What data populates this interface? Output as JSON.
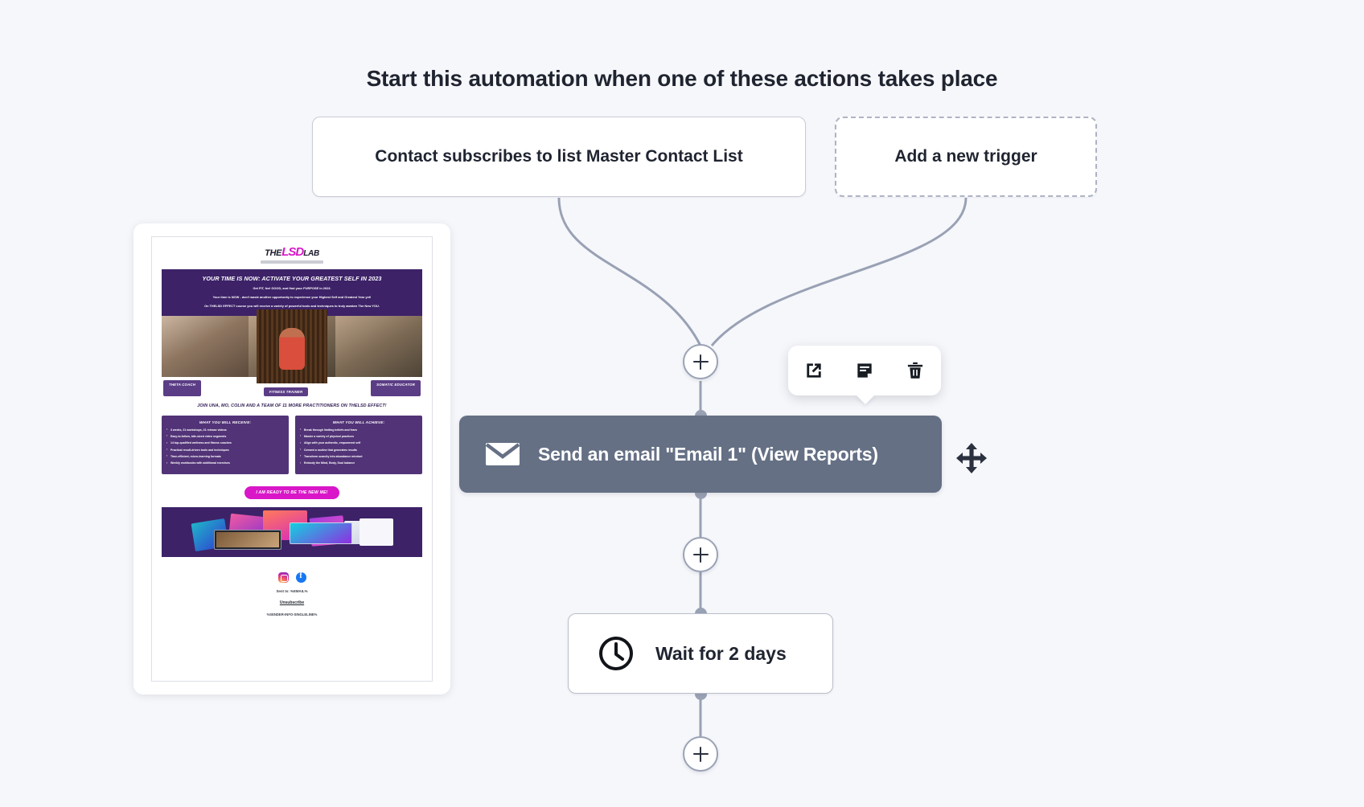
{
  "page": {
    "title": "Start this automation when one of these actions takes place"
  },
  "triggers": [
    {
      "label": "Contact subscribes to list Master Contact List",
      "style": "solid"
    },
    {
      "label": "Add a new trigger",
      "style": "dashed"
    }
  ],
  "nodes": {
    "email": {
      "label": "Send an email \"Email 1\" (View Reports)",
      "icon": "envelope-icon",
      "background": "#657085"
    },
    "wait": {
      "label": "Wait for 2 days",
      "icon": "clock-icon",
      "background": "#ffffff"
    }
  },
  "add_buttons": {
    "top_label": "+",
    "middle_label": "+",
    "bottom_label": "+"
  },
  "toolbar": {
    "open_icon": "external-link-icon",
    "duplicate_icon": "duplicate-icon",
    "delete_icon": "trash-icon"
  },
  "drag_handle": {
    "icon": "move-arrows-icon"
  },
  "email_preview": {
    "logo_the": "THE",
    "logo_lsd": "LSD",
    "logo_lab": "LAB",
    "hero_heading": "YOUR TIME IS NOW: ACTIVATE YOUR GREATEST SELF IN 2023",
    "hero_line1": "Get FIT, feel GOOD, and find your PURPOSE in 2023.",
    "hero_line2": "Your time is NOW - don't waste another opportunity to experience your Highest Self and Greatest Year yet!",
    "hero_line3": "On THELSD EFFECT course you will receive a variety of powerful tools and techniques to truly awaken The New YOU.",
    "roles": [
      "THETA COACH",
      "FITNESS TRAINER",
      "SOMATIC EDUCATOR"
    ],
    "join_line": "JOIN UNA, MO, COLIN AND A TEAM OF 11 MORE PRACTITIONERS ON THELSD EFFECT!",
    "receive_title": "WHAT YOU WILL RECEIVE:",
    "receive_items": [
      "3 weeks, 21 workshops, 21 release videos",
      "Easy-to-follow, bite-sized video segments",
      "14 top-qualified wellness and fitness coaches",
      "Practical result-driven tools and techniques",
      "Time-efficient, micro-learning formats",
      "Weekly workbooks with additional exercises"
    ],
    "achieve_title": "WHAT YOU WILL ACHIEVE:",
    "achieve_items": [
      "Break through limiting beliefs and fears",
      "Master a variety of physical practices",
      "Align with your authentic, empowered self",
      "Cement a routine that generates results",
      "Transform scarcity into abundance mindset",
      "Embody the Mind, Body, Soul balance"
    ],
    "cta_label": "I AM READY TO BE THE NEW ME!",
    "social": [
      "instagram-icon",
      "facebook-icon"
    ],
    "sent_to": "Sent to: %EMAIL%",
    "unsubscribe": "Unsubscribe",
    "sender_info": "%SENDER-INFO-SINGLELINE%"
  },
  "colors": {
    "canvas_bg": "#f6f7fb",
    "email_node": "#657085",
    "connector": "#99a1b4",
    "brand_purple": "#3d2268",
    "brand_magenta": "#d916c8"
  }
}
